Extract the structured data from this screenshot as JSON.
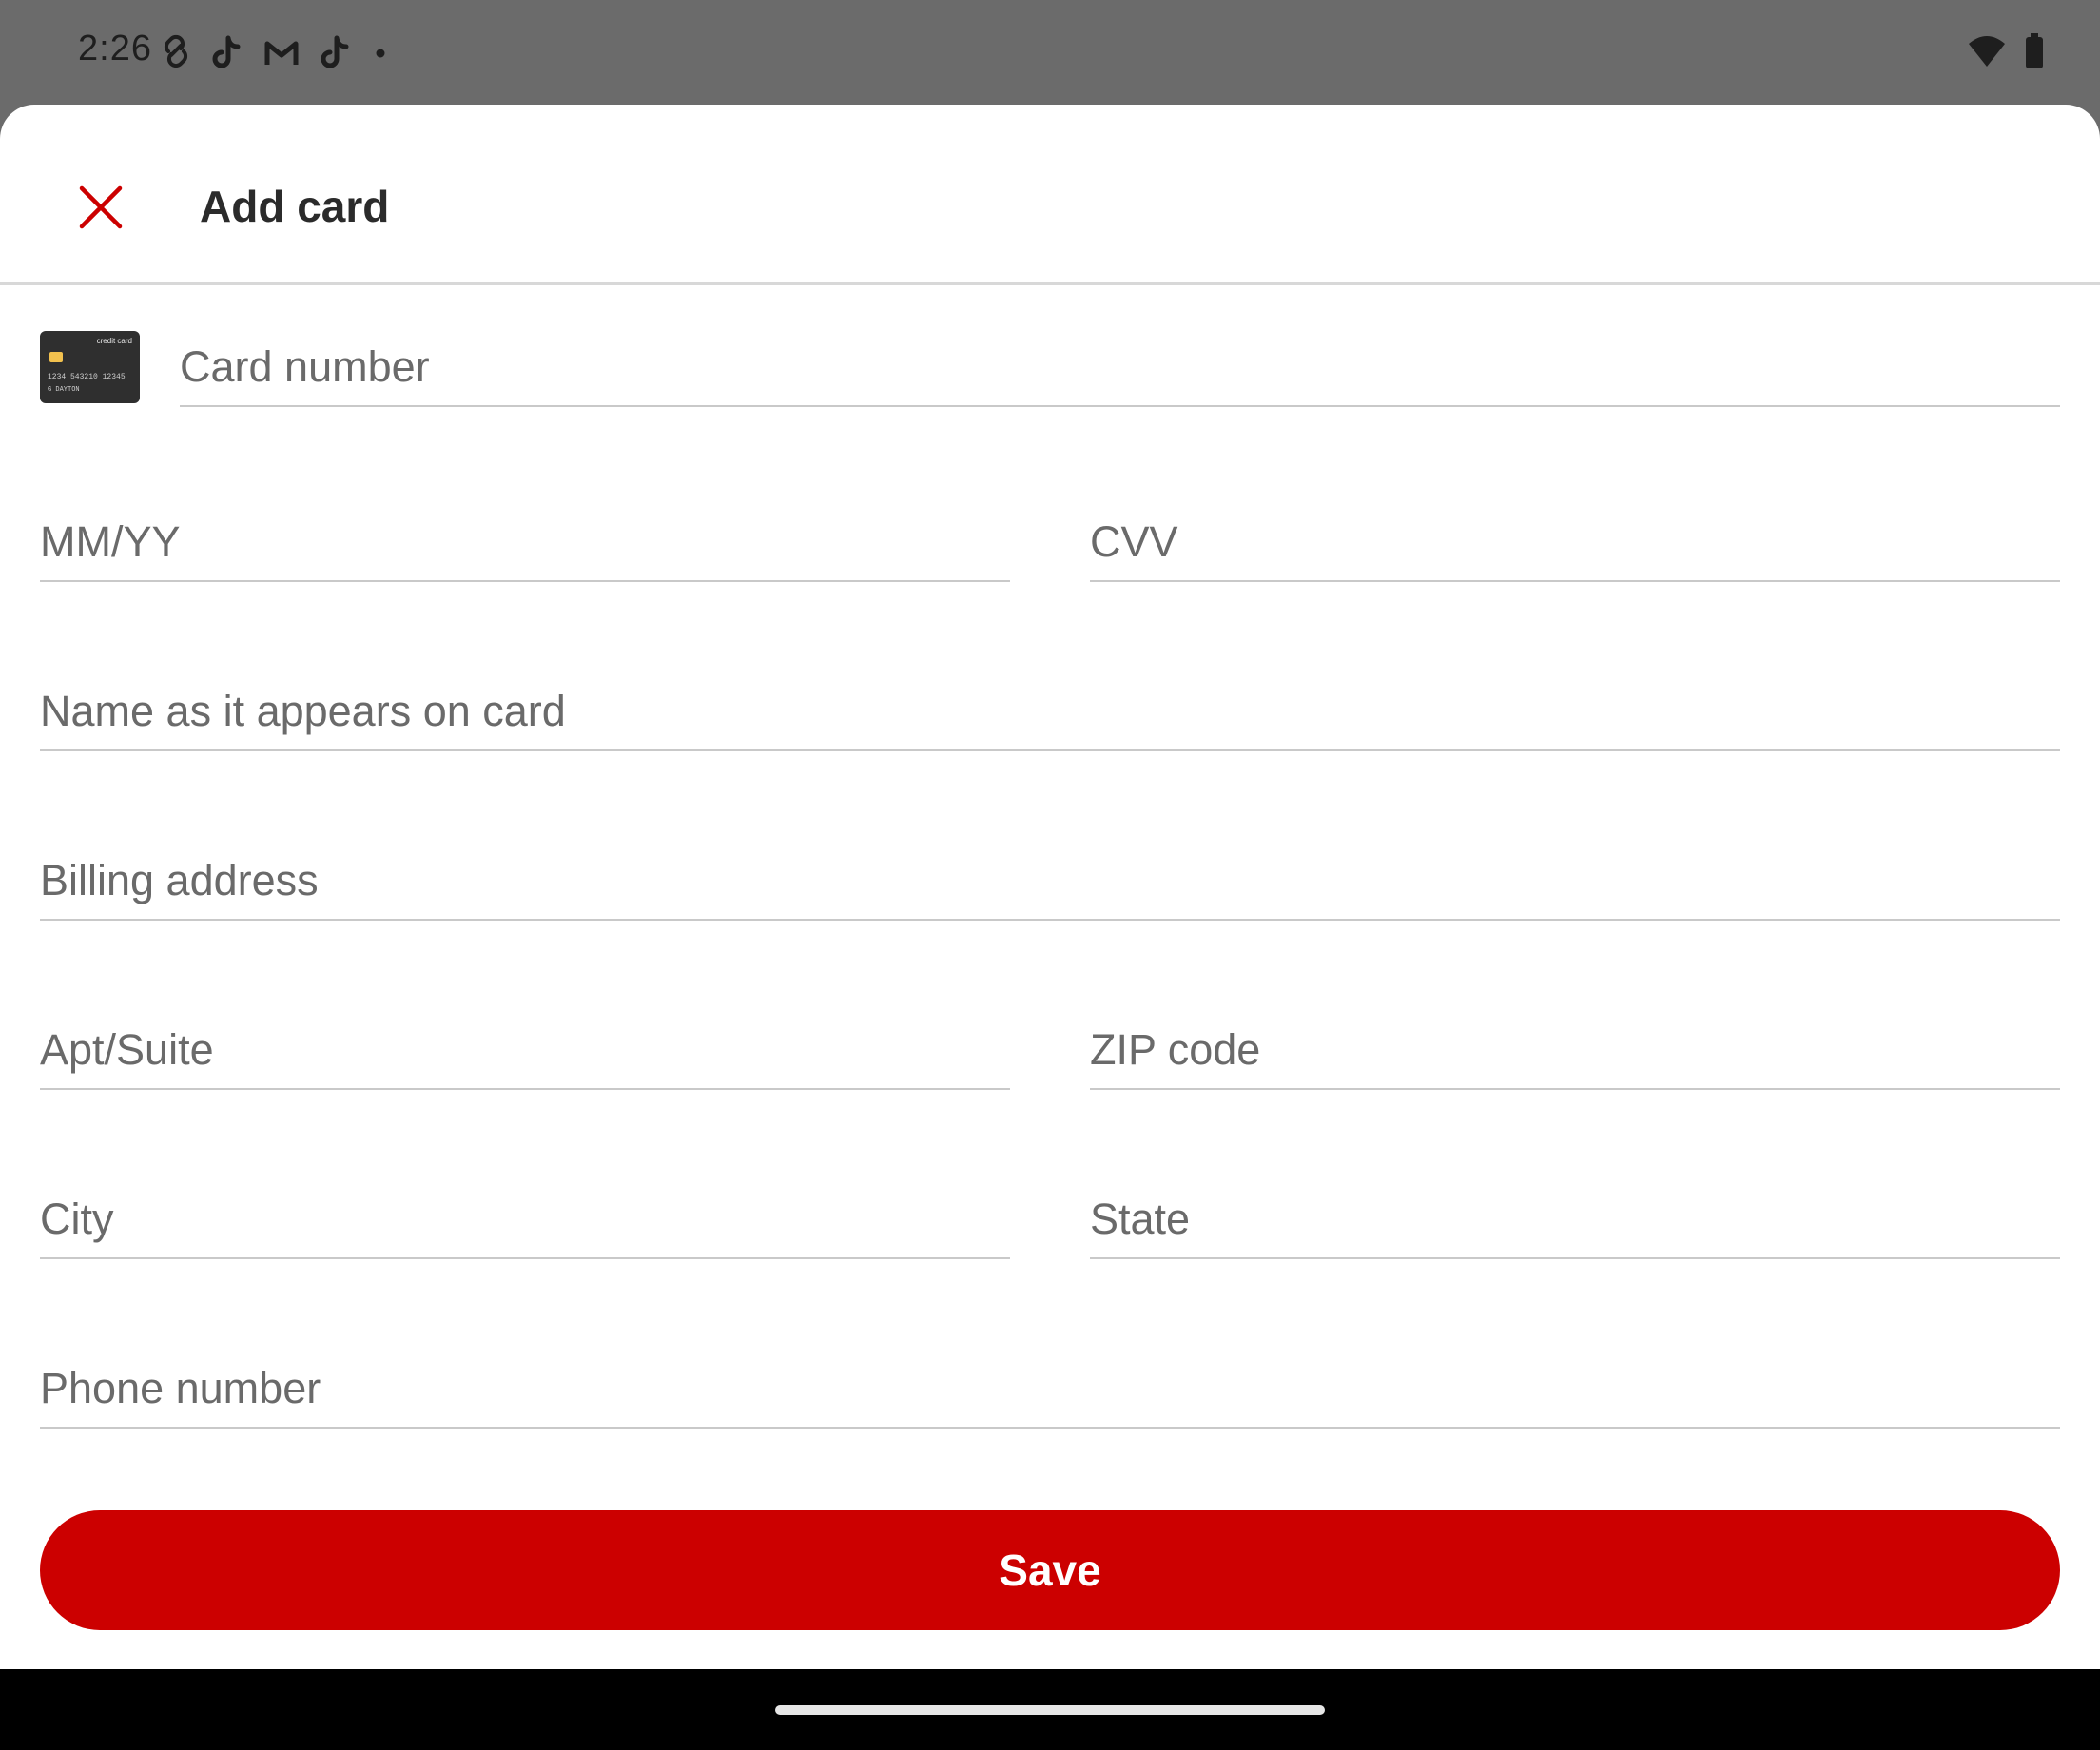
{
  "status_bar": {
    "time": "2:26",
    "left_icons": [
      "link-icon",
      "tiktok-icon",
      "gmail-icon",
      "tiktok-icon",
      "dot-icon"
    ],
    "right_icons": [
      "wifi-icon",
      "battery-icon"
    ]
  },
  "header": {
    "title": "Add card",
    "close_icon": "close-icon",
    "accent_color": "#cc0000"
  },
  "card_thumbnail": {
    "brand": "credit card",
    "number": "1234 543210 12345",
    "holder": "G DAYTON"
  },
  "form": {
    "card_number": {
      "placeholder": "Card number",
      "value": ""
    },
    "expiry": {
      "placeholder": "MM/YY",
      "value": ""
    },
    "cvv": {
      "placeholder": "CVV",
      "value": ""
    },
    "name": {
      "placeholder": "Name as it appears on card",
      "value": ""
    },
    "billing_address": {
      "placeholder": "Billing address",
      "value": ""
    },
    "apt_suite": {
      "placeholder": "Apt/Suite",
      "value": ""
    },
    "zip": {
      "placeholder": "ZIP code",
      "value": ""
    },
    "city": {
      "placeholder": "City",
      "value": ""
    },
    "state": {
      "placeholder": "State",
      "value": ""
    },
    "phone": {
      "placeholder": "Phone number",
      "value": ""
    }
  },
  "save_button": {
    "label": "Save",
    "color": "#cc0000"
  }
}
